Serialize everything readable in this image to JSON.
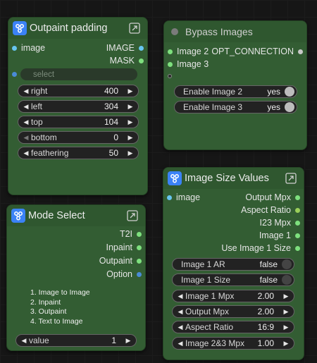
{
  "nodes": {
    "outpaint": {
      "title": "Outpaint padding",
      "inputs": [
        "image"
      ],
      "outputs": [
        "IMAGE",
        "MASK"
      ],
      "select_placeholder": "select",
      "widgets": [
        {
          "label": "right",
          "value": "400"
        },
        {
          "label": "left",
          "value": "304"
        },
        {
          "label": "top",
          "value": "104"
        },
        {
          "label": "bottom",
          "value": "0"
        },
        {
          "label": "feathering",
          "value": "50"
        }
      ]
    },
    "bypass": {
      "title": "Bypass Images",
      "inputs": [
        "Image 2",
        "Image 3"
      ],
      "outputs": [
        "OPT_CONNECTION"
      ],
      "toggles": [
        {
          "label": "Enable Image 2",
          "value": "yes"
        },
        {
          "label": "Enable Image 3",
          "value": "yes"
        }
      ]
    },
    "mode": {
      "title": "Mode Select",
      "outputs": [
        "T2I",
        "Inpaint",
        "Outpaint",
        "Option"
      ],
      "list": [
        "1. Image to Image",
        "2. Inpaint",
        "3. Outpaint",
        "4. Text to Image"
      ],
      "widget": {
        "label": "value",
        "value": "1"
      }
    },
    "size": {
      "title": "Image Size Values",
      "inputs": [
        "image"
      ],
      "outputs": [
        "Output Mpx",
        "Aspect Ratio",
        "I23 Mpx",
        "Image 1",
        "Use Image 1 Size"
      ],
      "toggles": [
        {
          "label": "Image 1 AR",
          "value": "false"
        },
        {
          "label": "Image 1 Size",
          "value": "false"
        }
      ],
      "widgets": [
        {
          "label": "Image 1 Mpx",
          "value": "2.00"
        },
        {
          "label": "Output Mpx",
          "value": "2.00"
        },
        {
          "label": "Aspect Ratio",
          "value": "16:9"
        },
        {
          "label": "Image 2&3 Mpx",
          "value": "1.00"
        }
      ]
    }
  },
  "colors": {
    "node_bg": "#335d33",
    "slot_image": "#67c5f0",
    "slot_mask": "#7ee07e",
    "slot_option": "#4a8bd6",
    "app_icon": "#3b82f6"
  },
  "icons": {
    "app": "node-graph-icon",
    "expand": "expand-icon",
    "increment": "triangle-right",
    "decrement": "triangle-left"
  }
}
